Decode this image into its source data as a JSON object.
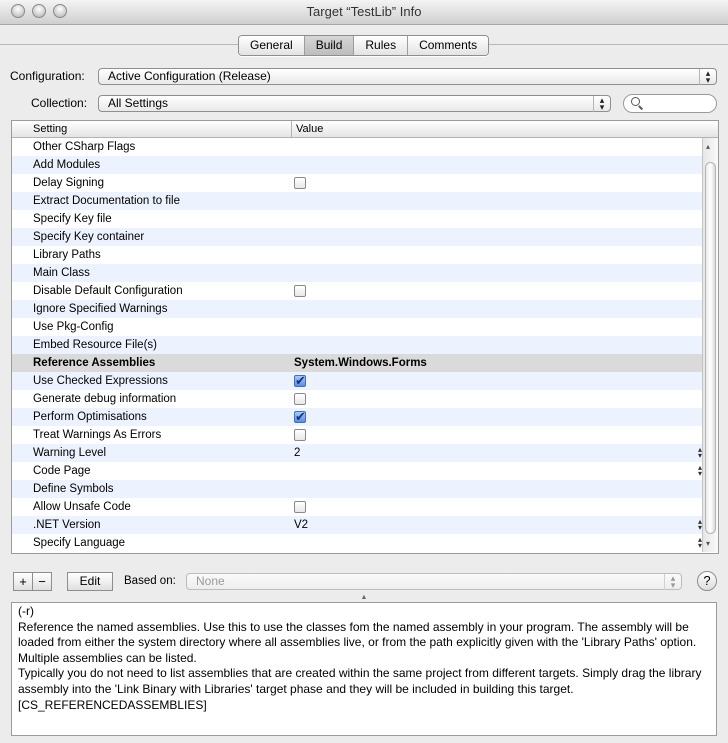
{
  "window": {
    "title": "Target “TestLib” Info",
    "buttons": [
      "close",
      "minimize",
      "zoom"
    ]
  },
  "tabs": [
    {
      "label": "General",
      "selected": false
    },
    {
      "label": "Build",
      "selected": true
    },
    {
      "label": "Rules",
      "selected": false
    },
    {
      "label": "Comments",
      "selected": false
    }
  ],
  "configuration": {
    "label": "Configuration:",
    "value": "Active Configuration (Release)"
  },
  "collection": {
    "label": "Collection:",
    "value": "All Settings"
  },
  "search": {
    "placeholder": "",
    "icon": "magnifier-icon"
  },
  "table": {
    "headers": {
      "setting": "Setting",
      "value": "Value"
    },
    "rows": [
      {
        "name": "Other CSharp Flags",
        "type": "text",
        "value": ""
      },
      {
        "name": "Add Modules",
        "type": "text",
        "value": ""
      },
      {
        "name": "Delay Signing",
        "type": "checkbox",
        "checked": false
      },
      {
        "name": "Extract Documentation to file",
        "type": "text",
        "value": ""
      },
      {
        "name": "Specify Key file",
        "type": "text",
        "value": ""
      },
      {
        "name": "Specify Key container",
        "type": "text",
        "value": ""
      },
      {
        "name": "Library Paths",
        "type": "text",
        "value": ""
      },
      {
        "name": "Main Class",
        "type": "text",
        "value": ""
      },
      {
        "name": "Disable Default Configuration",
        "type": "checkbox",
        "checked": false
      },
      {
        "name": "Ignore Specified Warnings",
        "type": "text",
        "value": ""
      },
      {
        "name": "Use Pkg-Config",
        "type": "text",
        "value": ""
      },
      {
        "name": "Embed Resource File(s)",
        "type": "text",
        "value": ""
      },
      {
        "name": "Reference Assemblies",
        "type": "text",
        "value": "System.Windows.Forms",
        "selected": true
      },
      {
        "name": "Use Checked Expressions",
        "type": "checkbox",
        "checked": true
      },
      {
        "name": "Generate debug information",
        "type": "checkbox",
        "checked": false
      },
      {
        "name": "Perform Optimisations",
        "type": "checkbox",
        "checked": true
      },
      {
        "name": "Treat Warnings As Errors",
        "type": "checkbox",
        "checked": false
      },
      {
        "name": "Warning Level",
        "type": "popup",
        "value": "2"
      },
      {
        "name": "Code Page",
        "type": "popup",
        "value": ""
      },
      {
        "name": "Define Symbols",
        "type": "text",
        "value": ""
      },
      {
        "name": "Allow Unsafe Code",
        "type": "checkbox",
        "checked": false
      },
      {
        "name": ".NET Version",
        "type": "popup",
        "value": "V2"
      },
      {
        "name": "Specify Language",
        "type": "popup",
        "value": ""
      }
    ]
  },
  "bottom": {
    "add": "+",
    "remove": "−",
    "edit": "Edit",
    "based_on_label": "Based on:",
    "based_on_value": "None",
    "help": "?"
  },
  "description": {
    "lines": [
      "(-r)",
      "Reference the named assemblies. Use this to use the classes fom the named assembly in your program. The assembly will be loaded from either the system directory where all assemblies live, or from the path explicitly given with the 'Library Paths' option.",
      "Multiple assemblies can be listed.",
      "Typically you do not need to list assemblies that are created within the same project from different targets. Simply drag the library assembly into the 'Link Binary with Libraries' target phase and they will be included in building this target.",
      "[CS_REFERENCEDASSEMBLIES]"
    ]
  }
}
